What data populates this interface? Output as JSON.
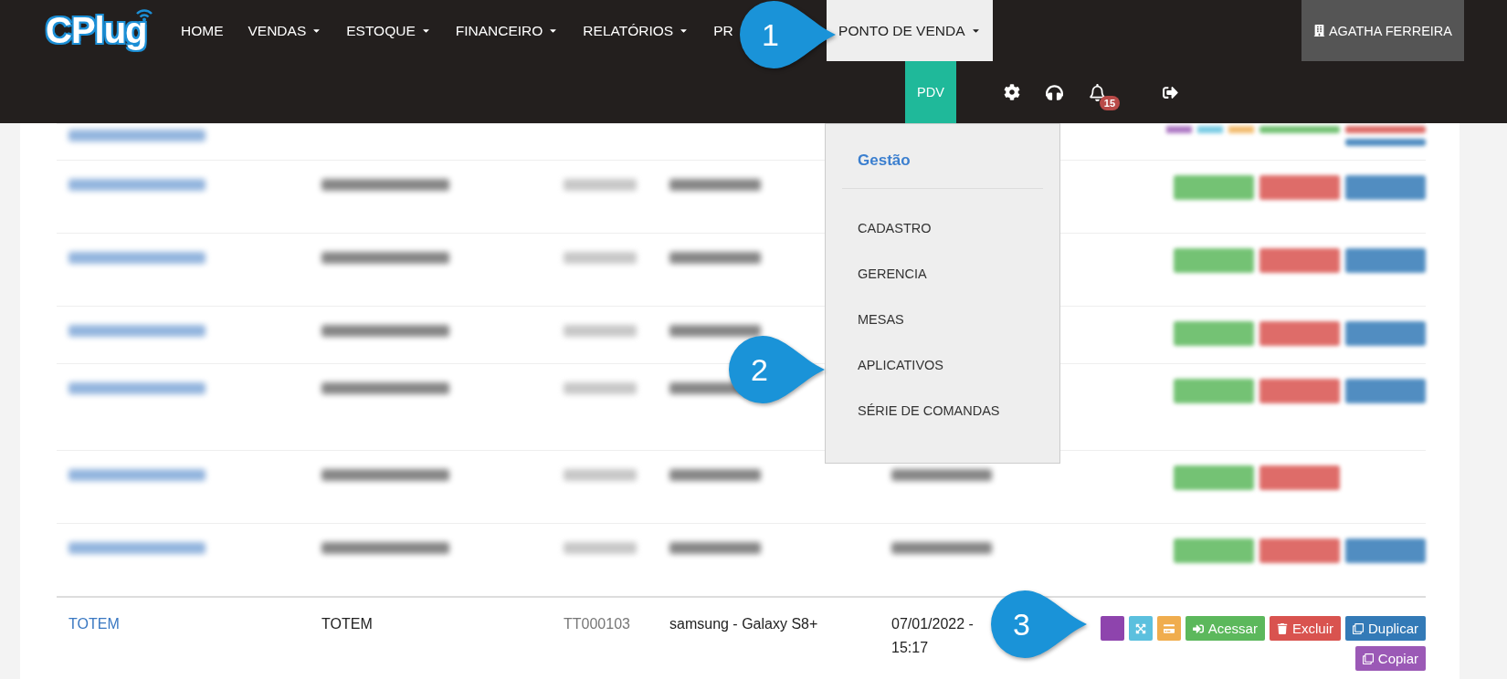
{
  "nav": {
    "logo": "CPlug",
    "items": [
      {
        "label": "HOME",
        "dropdown": false,
        "selected": false
      },
      {
        "label": "VENDAS",
        "dropdown": true,
        "selected": false
      },
      {
        "label": "ESTOQUE",
        "dropdown": true,
        "selected": false
      },
      {
        "label": "FINANCEIRO",
        "dropdown": true,
        "selected": false
      },
      {
        "label": "RELATÓRIOS",
        "dropdown": true,
        "selected": false
      },
      {
        "label": "PR",
        "dropdown": false,
        "selected": false
      },
      {
        "label": "PONTO DE VENDA",
        "dropdown": true,
        "selected": true
      }
    ],
    "user": "AGATHA FERREIRA",
    "pdv": "PDV",
    "notifications": "15"
  },
  "menu": {
    "header": "Gestão",
    "items": [
      "CADASTRO",
      "GERENCIA",
      "MESAS",
      "APLICATIVOS",
      "SÉRIE DE COMANDAS"
    ]
  },
  "blurred_rows": [
    {
      "kind": "partial",
      "date": false,
      "duplicate": true
    },
    {
      "kind": "double",
      "date": false,
      "duplicate": true
    },
    {
      "kind": "double",
      "date": false,
      "duplicate": true
    },
    {
      "kind": "single",
      "date": false,
      "duplicate": true
    },
    {
      "kind": "triple",
      "date": false,
      "duplicate": true
    },
    {
      "kind": "double",
      "date": true,
      "duplicate": false
    },
    {
      "kind": "double",
      "date": true,
      "duplicate": true
    }
  ],
  "row": {
    "cells": [
      "TOTEM",
      "TOTEM",
      "TT000103",
      "samsung - Galaxy S8+",
      "07/01/2022 -\n15:17"
    ],
    "buttons": [
      {
        "kind": "blank",
        "color": "#8e44ad"
      },
      {
        "kind": "expand",
        "color": "#5bc0de"
      },
      {
        "kind": "card",
        "color": "#f0ad4e"
      },
      {
        "kind": "access",
        "color": "#5cb85c",
        "label": "Acessar"
      },
      {
        "kind": "delete",
        "color": "#d9534f",
        "label": "Excluir"
      },
      {
        "kind": "duplicate",
        "color": "#337ab7",
        "label": "Duplicar"
      },
      {
        "kind": "copy",
        "color": "#9b59b6",
        "label": "Copiar"
      }
    ]
  },
  "callouts": [
    "1",
    "2",
    "3"
  ]
}
